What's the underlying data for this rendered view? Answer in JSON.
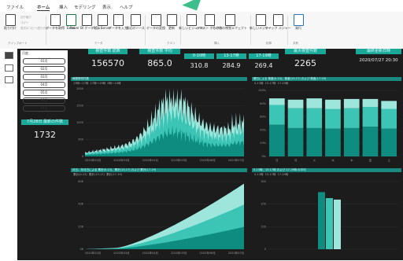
{
  "ribbon_tabs": [
    "ファイル",
    "ホーム",
    "挿入",
    "モデリング",
    "表示",
    "ヘルプ"
  ],
  "ribbon_buttons": [
    {
      "label": "貼り付け"
    },
    {
      "label": "データを取得"
    },
    {
      "label": "Excel"
    },
    {
      "label": "Power BI データセット"
    },
    {
      "label": "SQL Server"
    },
    {
      "label": "データを入力"
    },
    {
      "label": "最近のソース"
    },
    {
      "label": "データの変換"
    },
    {
      "label": "更新"
    },
    {
      "label": "新しいビジュアル"
    },
    {
      "label": "テキスト ボックス"
    },
    {
      "label": "その他の視覚エフェクト"
    },
    {
      "label": "新しいメジャー"
    },
    {
      "label": "クイック メジャー"
    },
    {
      "label": "発行"
    }
  ],
  "ribbon_small": [
    "切り取り",
    "コピー",
    "書式のコピー/貼り付け"
  ],
  "ribbon_groups": [
    "クリップボード",
    "データ",
    "クエリ",
    "挿入",
    "計算",
    "共有"
  ],
  "slicer": {
    "header": "月度",
    "items": [
      "01月",
      "02月",
      "03月",
      "04月",
      "05月",
      "06月",
      "07月"
    ]
  },
  "kpi_left": {
    "label": "7月28日 最新の件数",
    "value": "1732"
  },
  "cards": [
    {
      "label": "検査件数 総数",
      "value": "156570"
    },
    {
      "label": "検査件数 平均",
      "value": "865.0"
    },
    {
      "label": "最大検査件数",
      "value": "2265"
    },
    {
      "label": "最終更新日時",
      "value": "2020/07/27 20:30"
    }
  ],
  "time_bands": {
    "labels": [
      "0-10時",
      "13-17時",
      "17-19時"
    ],
    "values": [
      "310.8",
      "284.9",
      "269.4"
    ]
  },
  "vis1": {
    "title": "時間帯別件数",
    "legend": [
      "13時〜17時",
      "17時〜19時",
      "0時〜10時"
    ],
    "yticks": [
      "2000",
      "1500",
      "1000",
      "500",
      "0"
    ],
    "xticks": [
      "2020年02月",
      "2020年03月",
      "2020年04月",
      "2020年05月",
      "2020年06月",
      "2020年07月"
    ]
  },
  "vis2": {
    "title": "曜日による 検査(0-13)、検査(13-17) および 検査(17-19)",
    "legend": [
      "0-13時",
      "13-17時",
      "17-19時"
    ],
    "yticks": [
      "100%",
      "80%",
      "60%",
      "40%",
      "20%",
      "0%"
    ],
    "xticks": [
      "日",
      "月",
      "火",
      "水",
      "木",
      "金",
      "土"
    ]
  },
  "vis3": {
    "title": "月日、年月日による 累計(0-13)、累計(13-17) および 累計(17-19)",
    "legend": [
      "累計(0-13)",
      "累計(13-17)",
      "累計(17-19)"
    ],
    "yticks": [
      "60K",
      "40K",
      "20K",
      "0K"
    ],
    "xticks": [
      "2020年02月",
      "2020年03月",
      "2020年04月",
      "2020年05月",
      "2020年06月",
      "2020年07月"
    ]
  },
  "vis4": {
    "title": "0-13時、13-17時 および 17-19時 の平均",
    "legend": [
      "0-13時",
      "13-17時",
      "17-19時"
    ],
    "yticks": [
      "300",
      "200",
      "100",
      "0"
    ],
    "values": [
      380,
      340,
      330
    ]
  },
  "colors": {
    "teal_light": "#9ee5dc",
    "teal_mid": "#3cc5b5",
    "teal_dark": "#0e8c80",
    "bg": "#1c1c1c"
  },
  "chart_data": [
    {
      "type": "area",
      "title": "時間帯別件数",
      "series": [
        {
          "name": "13時〜17時"
        },
        {
          "name": "17時〜19時"
        },
        {
          "name": "0時〜10時"
        }
      ],
      "ylim": [
        0,
        2000
      ]
    },
    {
      "type": "bar",
      "title": "曜日による 検査(0-13)、検査(13-17) および 検査(17-19)",
      "categories": [
        "日",
        "月",
        "火",
        "水",
        "木",
        "金",
        "土"
      ],
      "series": [
        {
          "name": "0-13時",
          "values": [
            48,
            43,
            43,
            42,
            43,
            45,
            42
          ]
        },
        {
          "name": "13-17時",
          "values": [
            30,
            30,
            30,
            30,
            30,
            30,
            30
          ]
        },
        {
          "name": "17-19時",
          "values": [
            10,
            13,
            15,
            14,
            14,
            12,
            12
          ]
        }
      ],
      "ylim": [
        0,
        100
      ]
    },
    {
      "type": "area",
      "title": "累計",
      "series": [
        {
          "name": "累計(0-13)"
        },
        {
          "name": "累計(13-17)"
        },
        {
          "name": "累計(17-19)"
        }
      ],
      "ylim": [
        0,
        60000
      ]
    },
    {
      "type": "bar",
      "title": "0-13時、13-17時 および 17-19時 の平均",
      "categories": [
        "0-13時",
        "13-17時",
        "17-19時"
      ],
      "values": [
        380,
        340,
        330
      ],
      "ylim": [
        0,
        450
      ]
    }
  ]
}
